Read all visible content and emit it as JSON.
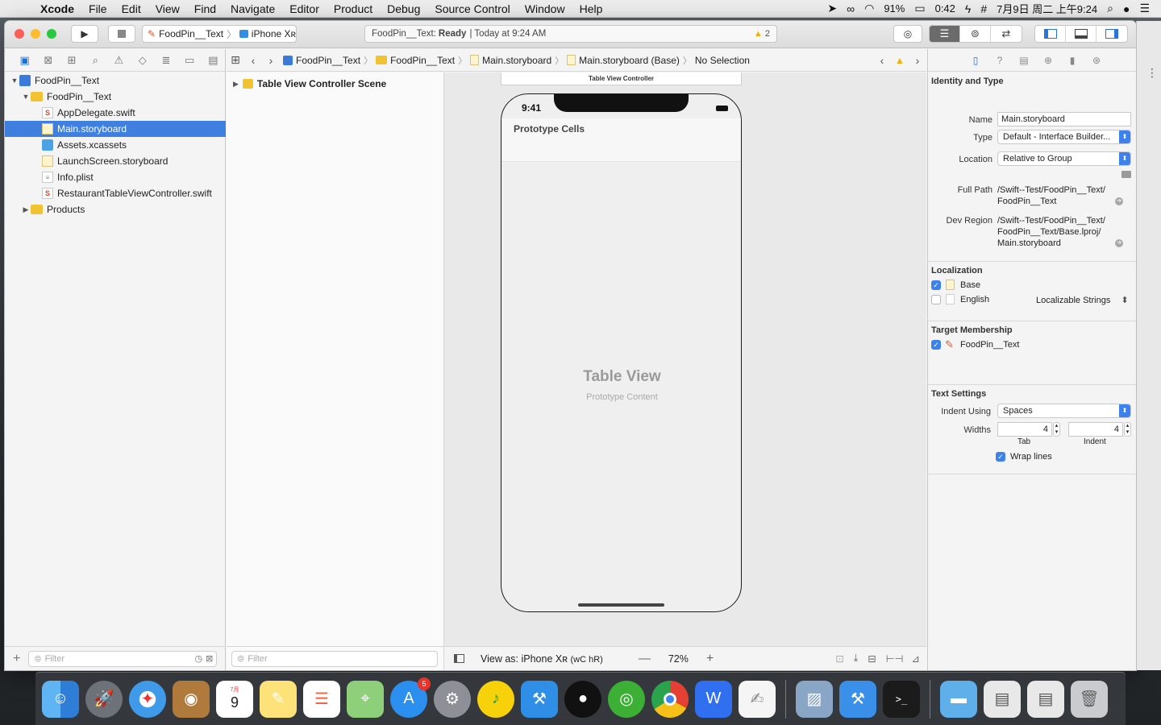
{
  "menubar": {
    "app": "Xcode",
    "menus": [
      "File",
      "Edit",
      "View",
      "Find",
      "Navigate",
      "Editor",
      "Product",
      "Debug",
      "Source Control",
      "Window",
      "Help"
    ],
    "battery": "91%",
    "timer": "0:42",
    "datetime": "7月9日 周二 上午9:24"
  },
  "toolbar": {
    "scheme": "FoodPin__Text",
    "device": "iPhone Xʀ",
    "activity_project": "FoodPin__Text:",
    "activity_status": "Ready",
    "activity_time": "| Today at 9:24 AM",
    "warning_count": "2"
  },
  "navigator": {
    "items": [
      {
        "label": "FoodPin__Text",
        "type": "project",
        "indent": 0,
        "tri": "▼"
      },
      {
        "label": "FoodPin__Text",
        "type": "folder",
        "indent": 1,
        "tri": "▼"
      },
      {
        "label": "AppDelegate.swift",
        "type": "swift",
        "indent": 2,
        "tri": ""
      },
      {
        "label": "Main.storyboard",
        "type": "storyboard",
        "indent": 2,
        "tri": "",
        "selected": true
      },
      {
        "label": "Assets.xcassets",
        "type": "assets",
        "indent": 2,
        "tri": ""
      },
      {
        "label": "LaunchScreen.storyboard",
        "type": "storyboard",
        "indent": 2,
        "tri": ""
      },
      {
        "label": "Info.plist",
        "type": "plist",
        "indent": 2,
        "tri": ""
      },
      {
        "label": "RestaurantTableViewController.swift",
        "type": "swift",
        "indent": 2,
        "tri": ""
      },
      {
        "label": "Products",
        "type": "folder",
        "indent": 1,
        "tri": "▶"
      }
    ],
    "filter_placeholder": "Filter"
  },
  "jumpbar": {
    "crumbs": [
      "FoodPin__Text",
      "FoodPin__Text",
      "Main.storyboard",
      "Main.storyboard (Base)",
      "No Selection"
    ]
  },
  "outline": {
    "scene": "Table View Controller Scene",
    "filter_placeholder": "Filter"
  },
  "canvas": {
    "vc_title": "Table View Controller",
    "time": "9:41",
    "prototype_cells": "Prototype Cells",
    "table_view": "Table View",
    "prototype_content": "Prototype Content",
    "view_as": "View as: iPhone Xʀ",
    "size_class": "(wC hR)",
    "zoom": "72%"
  },
  "inspector": {
    "identity_title": "Identity and Type",
    "name_label": "Name",
    "name_value": "Main.storyboard",
    "type_label": "Type",
    "type_value": "Default - Interface Builder...",
    "location_label": "Location",
    "location_value": "Relative to Group",
    "fullpath_label": "Full Path",
    "fullpath_line1": "/Swift--Test/FoodPin__Text/",
    "fullpath_line2": "FoodPin__Text",
    "devregion_label": "Dev Region",
    "devregion_line1": "/Swift--Test/FoodPin__Text/",
    "devregion_line2": "FoodPin__Text/Base.lproj/",
    "devregion_line3": "Main.storyboard",
    "localization_title": "Localization",
    "loc_base": "Base",
    "loc_english": "English",
    "loc_strings": "Localizable Strings",
    "target_title": "Target Membership",
    "target_name": "FoodPin__Text",
    "text_settings_title": "Text Settings",
    "indent_using_label": "Indent Using",
    "indent_using_value": "Spaces",
    "widths_label": "Widths",
    "tab_value": "4",
    "indent_value": "4",
    "tab_caption": "Tab",
    "indent_caption": "Indent",
    "wrap_lines": "Wrap lines"
  },
  "dock": {
    "calendar_day": "9",
    "calendar_month": "7月",
    "appstore_badge": "5"
  },
  "colors": {
    "selection": "#3f7fe0",
    "accent": "#3d82ec",
    "folder": "#f1c232",
    "warning": "#f0b400"
  }
}
